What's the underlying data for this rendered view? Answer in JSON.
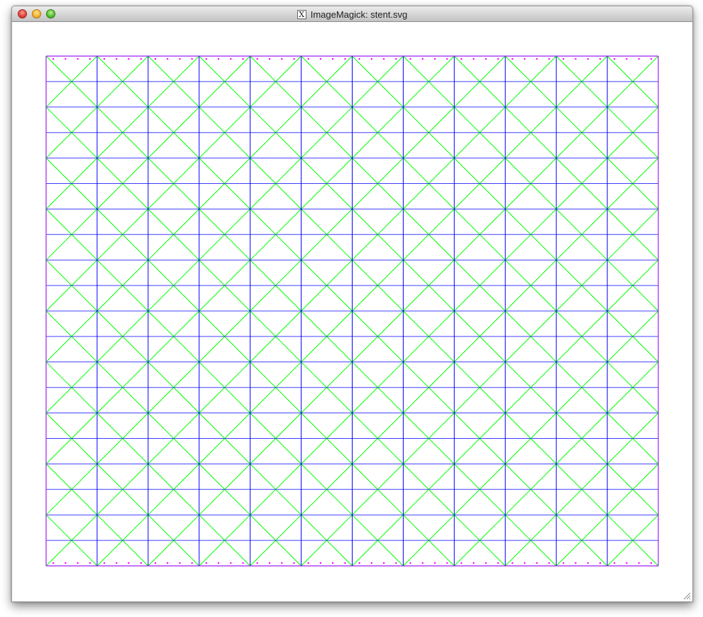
{
  "window": {
    "title": "ImageMagick: stent.svg",
    "title_icon": "X",
    "buttons": {
      "close": "close-button",
      "minimize": "minimize-button",
      "zoom": "zoom-button"
    }
  },
  "drawing": {
    "columns": 12,
    "rows": 20,
    "colors": {
      "border": "#a020f0",
      "vertical_lines": "#0000ff",
      "horizontal_lines": "#4040ff",
      "diagonals": "#00ff00",
      "edge_dots": "#ff00ff"
    },
    "dots_per_cell_edge": 4
  }
}
